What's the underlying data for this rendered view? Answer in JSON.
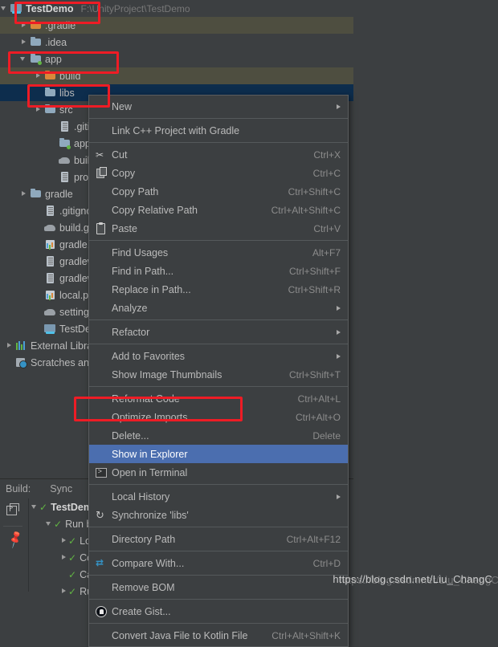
{
  "project": {
    "root_label": "TestDemo",
    "root_path": "F:\\UnityProject\\TestDemo",
    "rows": [
      {
        "label": ".gradle",
        "icon": "folder-orange",
        "indent": 1,
        "twig": "right",
        "alt": true,
        "sel": false
      },
      {
        "label": ".idea",
        "icon": "folder-blue",
        "indent": 1,
        "twig": "right",
        "alt": false,
        "sel": false
      },
      {
        "label": "app",
        "icon": "folder-module",
        "indent": 1,
        "twig": "down",
        "alt": false,
        "sel": false
      },
      {
        "label": "build",
        "icon": "folder-orange",
        "indent": 2,
        "twig": "right",
        "alt": true,
        "sel": false
      },
      {
        "label": "libs",
        "icon": "folder-blue",
        "indent": 2,
        "twig": "none",
        "alt": false,
        "sel": true
      },
      {
        "label": "src",
        "icon": "folder-blue",
        "indent": 2,
        "twig": "right",
        "alt": false,
        "sel": false
      },
      {
        "label": ".gitignore",
        "icon": "file-doc",
        "indent": 3,
        "twig": "none",
        "alt": false,
        "sel": false
      },
      {
        "label": "app.iml",
        "icon": "folder-module",
        "indent": 3,
        "twig": "none",
        "alt": false,
        "sel": false
      },
      {
        "label": "build.gradle",
        "icon": "file-gradle",
        "indent": 3,
        "twig": "none",
        "alt": false,
        "sel": false
      },
      {
        "label": "proguard-rules.pro",
        "icon": "file-doc",
        "indent": 3,
        "twig": "none",
        "alt": false,
        "sel": false
      },
      {
        "label": "gradle",
        "icon": "folder-blue",
        "indent": 1,
        "twig": "right",
        "alt": false,
        "sel": false
      },
      {
        "label": ".gitignore",
        "icon": "file-doc",
        "indent": 2,
        "twig": "none",
        "alt": false,
        "sel": false
      },
      {
        "label": "build.gradle",
        "icon": "file-gradle",
        "indent": 2,
        "twig": "none",
        "alt": false,
        "sel": false
      },
      {
        "label": "gradle.properties",
        "icon": "file-props",
        "indent": 2,
        "twig": "none",
        "alt": false,
        "sel": false
      },
      {
        "label": "gradlew",
        "icon": "file-doc",
        "indent": 2,
        "twig": "none",
        "alt": false,
        "sel": false
      },
      {
        "label": "gradlew.bat",
        "icon": "file-doc",
        "indent": 2,
        "twig": "none",
        "alt": false,
        "sel": false
      },
      {
        "label": "local.properties",
        "icon": "file-props",
        "indent": 2,
        "twig": "none",
        "alt": false,
        "sel": false
      },
      {
        "label": "settings.gradle",
        "icon": "file-gradle",
        "indent": 2,
        "twig": "none",
        "alt": false,
        "sel": false
      },
      {
        "label": "TestDemo.iml",
        "icon": "module-proj",
        "indent": 2,
        "twig": "none",
        "alt": false,
        "sel": false
      },
      {
        "label": "External Libraries",
        "icon": "bars",
        "indent": 0,
        "twig": "right",
        "alt": false,
        "sel": false
      },
      {
        "label": "Scratches and Consoles",
        "icon": "clock",
        "indent": 0,
        "twig": "none",
        "alt": false,
        "sel": false
      }
    ]
  },
  "context_menu": {
    "items": [
      {
        "label": "New",
        "icon": "",
        "shortcut": "",
        "submenu": true,
        "sep_after": true,
        "highlight": false
      },
      {
        "label": "Link C++ Project with Gradle",
        "icon": "",
        "shortcut": "",
        "submenu": false,
        "sep_after": true,
        "highlight": false
      },
      {
        "label": "Cut",
        "icon": "scissors",
        "shortcut": "Ctrl+X",
        "submenu": false,
        "sep_after": false,
        "highlight": false
      },
      {
        "label": "Copy",
        "icon": "copy",
        "shortcut": "Ctrl+C",
        "submenu": false,
        "sep_after": false,
        "highlight": false
      },
      {
        "label": "Copy Path",
        "icon": "",
        "shortcut": "Ctrl+Shift+C",
        "submenu": false,
        "sep_after": false,
        "highlight": false
      },
      {
        "label": "Copy Relative Path",
        "icon": "",
        "shortcut": "Ctrl+Alt+Shift+C",
        "submenu": false,
        "sep_after": false,
        "highlight": false
      },
      {
        "label": "Paste",
        "icon": "paste",
        "shortcut": "Ctrl+V",
        "submenu": false,
        "sep_after": true,
        "highlight": false
      },
      {
        "label": "Find Usages",
        "icon": "",
        "shortcut": "Alt+F7",
        "submenu": false,
        "sep_after": false,
        "highlight": false
      },
      {
        "label": "Find in Path...",
        "icon": "",
        "shortcut": "Ctrl+Shift+F",
        "submenu": false,
        "sep_after": false,
        "highlight": false
      },
      {
        "label": "Replace in Path...",
        "icon": "",
        "shortcut": "Ctrl+Shift+R",
        "submenu": false,
        "sep_after": false,
        "highlight": false
      },
      {
        "label": "Analyze",
        "icon": "",
        "shortcut": "",
        "submenu": true,
        "sep_after": true,
        "highlight": false
      },
      {
        "label": "Refactor",
        "icon": "",
        "shortcut": "",
        "submenu": true,
        "sep_after": true,
        "highlight": false
      },
      {
        "label": "Add to Favorites",
        "icon": "",
        "shortcut": "",
        "submenu": true,
        "sep_after": false,
        "highlight": false
      },
      {
        "label": "Show Image Thumbnails",
        "icon": "",
        "shortcut": "Ctrl+Shift+T",
        "submenu": false,
        "sep_after": true,
        "highlight": false
      },
      {
        "label": "Reformat Code",
        "icon": "",
        "shortcut": "Ctrl+Alt+L",
        "submenu": false,
        "sep_after": false,
        "highlight": false
      },
      {
        "label": "Optimize Imports",
        "icon": "",
        "shortcut": "Ctrl+Alt+O",
        "submenu": false,
        "sep_after": false,
        "highlight": false
      },
      {
        "label": "Delete...",
        "icon": "",
        "shortcut": "Delete",
        "submenu": false,
        "sep_after": false,
        "highlight": false
      },
      {
        "label": "Show in Explorer",
        "icon": "",
        "shortcut": "",
        "submenu": false,
        "sep_after": false,
        "highlight": true
      },
      {
        "label": "Open in Terminal",
        "icon": "terminal",
        "shortcut": "",
        "submenu": false,
        "sep_after": true,
        "highlight": false
      },
      {
        "label": "Local History",
        "icon": "",
        "shortcut": "",
        "submenu": true,
        "sep_after": false,
        "highlight": false
      },
      {
        "label": "Synchronize 'libs'",
        "icon": "sync",
        "shortcut": "",
        "submenu": false,
        "sep_after": true,
        "highlight": false
      },
      {
        "label": "Directory Path",
        "icon": "",
        "shortcut": "Ctrl+Alt+F12",
        "submenu": false,
        "sep_after": true,
        "highlight": false
      },
      {
        "label": "Compare With...",
        "icon": "compare",
        "shortcut": "Ctrl+D",
        "submenu": false,
        "sep_after": true,
        "highlight": false
      },
      {
        "label": "Remove BOM",
        "icon": "",
        "shortcut": "",
        "submenu": false,
        "sep_after": true,
        "highlight": false
      },
      {
        "label": "Create Gist...",
        "icon": "gist",
        "shortcut": "",
        "submenu": false,
        "sep_after": true,
        "highlight": false
      },
      {
        "label": "Convert Java File to Kotlin File",
        "icon": "",
        "shortcut": "Ctrl+Alt+Shift+K",
        "submenu": false,
        "sep_after": false,
        "highlight": false
      }
    ]
  },
  "build_panel": {
    "title": "Build:",
    "tab": "Sync",
    "rows": [
      {
        "label": "TestDemo",
        "indent": 0,
        "twig": "down",
        "check": true
      },
      {
        "label": "Run build",
        "indent": 1,
        "twig": "down",
        "check": true
      },
      {
        "label": "Load build",
        "indent": 2,
        "twig": "right",
        "check": true
      },
      {
        "label": "Configure build",
        "indent": 2,
        "twig": "right",
        "check": true
      },
      {
        "label": "Calculate task graph",
        "indent": 2,
        "twig": "none",
        "check": true
      },
      {
        "label": "Run tasks",
        "indent": 2,
        "twig": "right",
        "check": true
      }
    ]
  },
  "annotations": {
    "boxes": [
      "root-label",
      "app-row",
      "libs-row",
      "show-in-explorer"
    ],
    "color": "#ee1c25"
  },
  "watermark": {
    "text": "https://blog.csdn.net/Liu_ChangC"
  }
}
